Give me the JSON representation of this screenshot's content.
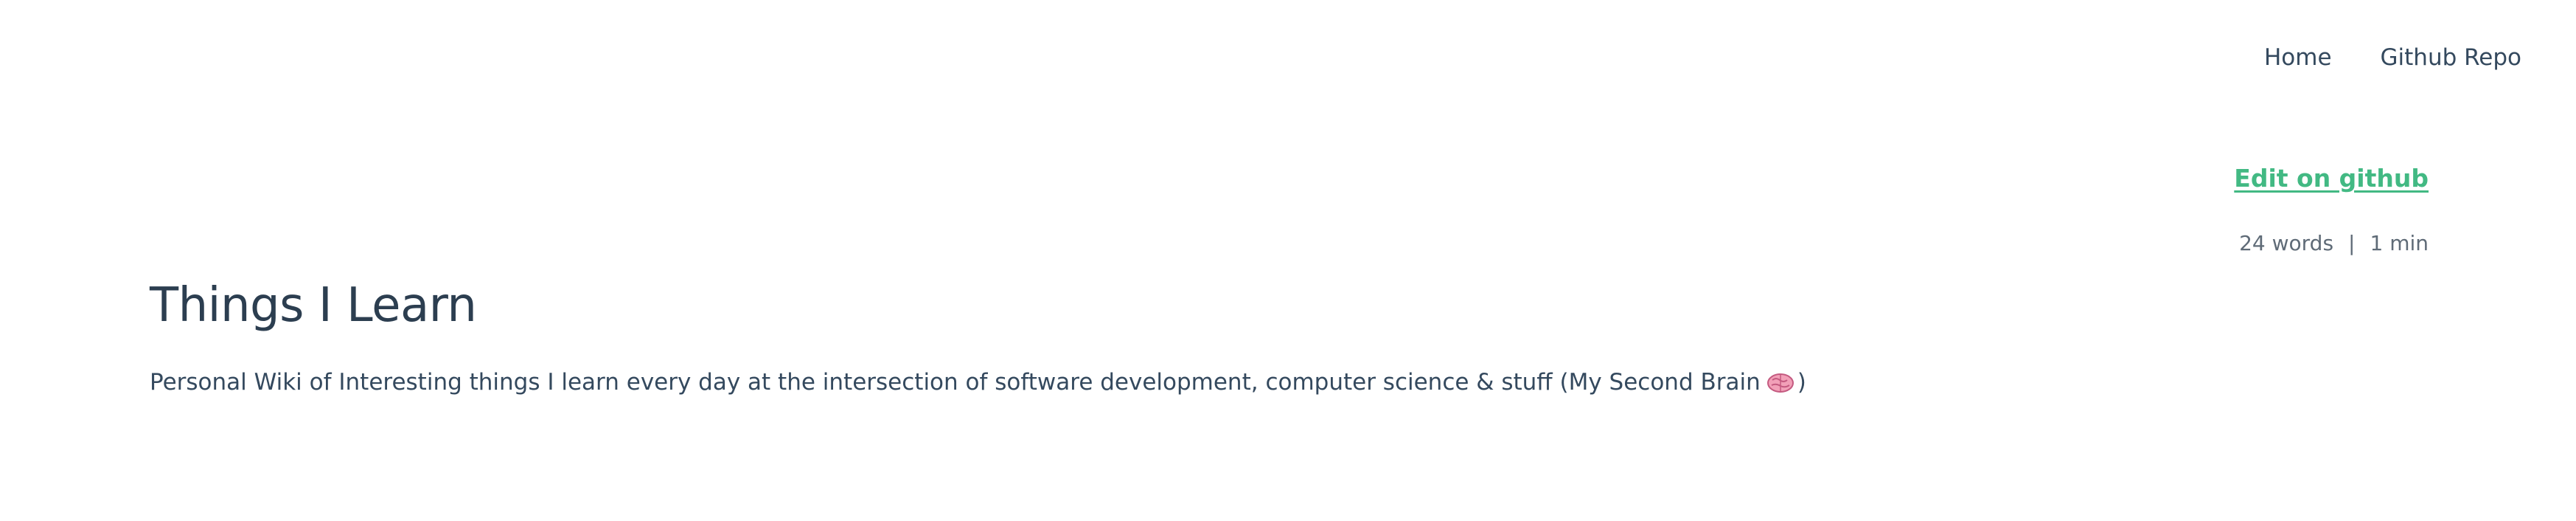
{
  "nav": {
    "items": [
      {
        "label": "Home"
      },
      {
        "label": "Github Repo"
      }
    ]
  },
  "article": {
    "edit_link": "Edit on github",
    "meta": {
      "words": "24 words",
      "separator": "|",
      "read_time": "1 min"
    },
    "title": "Things I Learn",
    "description_prefix": "Personal Wiki of Interesting things I learn every day at the intersection of software development, computer science & stuff (My Second Brain",
    "description_suffix": ")",
    "icon": "brain-icon"
  },
  "colors": {
    "accent": "#42b983",
    "text": "#34495e",
    "heading": "#2c3e50",
    "meta": "#5f6b77",
    "background": "#ffffff"
  }
}
